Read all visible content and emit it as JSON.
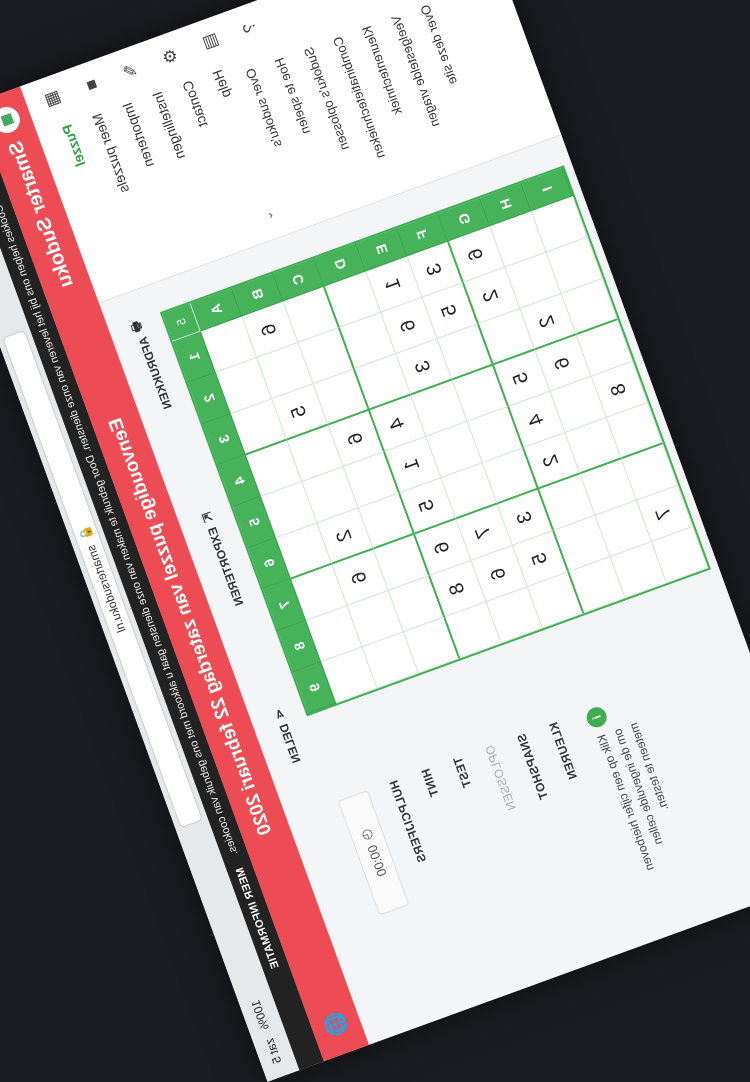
{
  "browser": {
    "url": "smartersudoku.nl",
    "status": [
      "100%",
      "zat 5"
    ]
  },
  "cookie_bar": {
    "text": "Cookies helpen ons bij het leveren van onze diensten. Door gebruik te maken van onze diensten gaat u akkoord met ons gebruik van cookies.",
    "more": "MEER INFORMATIE"
  },
  "header": {
    "logo": "▦",
    "title": "Smarter Sudoku",
    "subtitle": "Eenvoudige puzzel van zaterdag 22 februari 2020",
    "globe": "🌐"
  },
  "sidebar": {
    "icons": [
      "grid-icon",
      "folder-icon",
      "pencil-icon",
      "gear-icon",
      "contact-icon",
      "help-icon"
    ],
    "items": [
      {
        "label": "Puzzel",
        "active": true
      },
      {
        "label": "Meer puzzels"
      },
      {
        "label": "Importeren"
      },
      {
        "label": "Instellingen"
      },
      {
        "label": "Contact"
      },
      {
        "label": "Help"
      },
      {
        "label": "Over sudoku's"
      },
      {
        "label": "Hoe te spelen"
      },
      {
        "label": "Sudoku's oplossen"
      },
      {
        "label": "Combinatietechnieken"
      },
      {
        "label": "Kleurentechniek"
      },
      {
        "label": "Veelgestelde vragen"
      },
      {
        "label": "Over deze site"
      }
    ]
  },
  "toolbar": {
    "print": "AFDRUKKEN",
    "export": "EXPORTEREN",
    "share": "DELEN"
  },
  "grid": {
    "corner": "5",
    "cols": [
      "1",
      "2",
      "3",
      "4",
      "5",
      "6",
      "7",
      "8",
      "9"
    ],
    "rows": [
      "A",
      "B",
      "C",
      "D",
      "E",
      "F",
      "G",
      "H",
      "I"
    ],
    "cells": [
      [
        "",
        "",
        "",
        "",
        "",
        "",
        "",
        "",
        ""
      ],
      [
        "6",
        "",
        "5",
        "",
        "",
        "2",
        "6",
        "",
        ""
      ],
      [
        "",
        "",
        "",
        "6",
        "",
        "",
        "",
        "",
        ""
      ],
      [
        "",
        "",
        "",
        "4",
        "1",
        "5",
        "6",
        "8",
        ""
      ],
      [
        "1",
        "6",
        "3",
        "",
        "",
        "",
        "7",
        "6",
        ""
      ],
      [
        "3",
        "5",
        "",
        "",
        "",
        "",
        "3",
        "5",
        ""
      ],
      [
        "6",
        "2",
        "",
        "5",
        "4",
        "2",
        "",
        "",
        ""
      ],
      [
        "",
        "",
        "2",
        "6",
        "",
        "",
        "",
        "",
        ""
      ],
      [
        "",
        "",
        "",
        "",
        "8",
        "",
        "",
        "7",
        ""
      ]
    ]
  },
  "right_panel": {
    "timer": "00:00",
    "items": [
      "HULPCIJFERS",
      "HINT",
      "TEST",
      "OPLOSSEN",
      "SNAPSHOT",
      "KLEUREN"
    ],
    "disabled_index": 3,
    "hint": "Klik op een cijfer hierboven om de ingevulde cellen meteen te testen."
  }
}
